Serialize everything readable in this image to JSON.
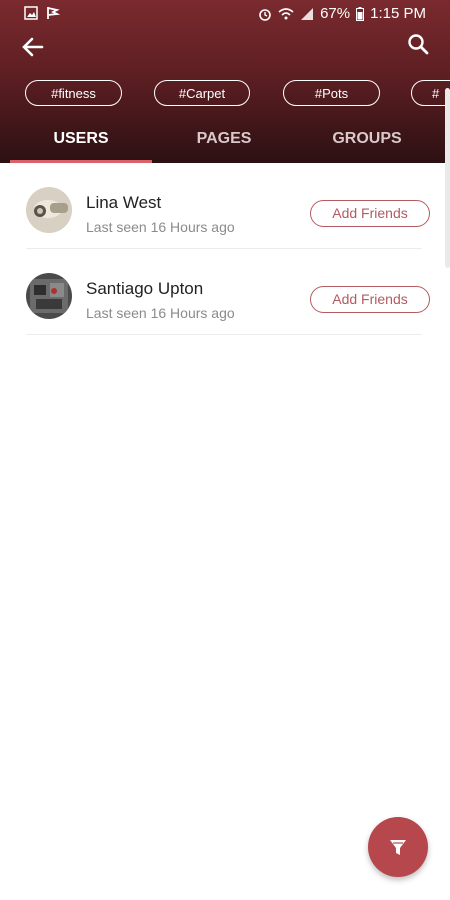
{
  "status_bar": {
    "battery": "67%",
    "time": "1:15 PM"
  },
  "chips": [
    "#fitness",
    "#Carpet",
    "#Pots",
    "#"
  ],
  "tabs": {
    "users": "USERS",
    "pages": "PAGES",
    "groups": "GROUPS",
    "active": "USERS"
  },
  "users": [
    {
      "name": "Lina West",
      "last_seen": "Last seen 16 Hours ago",
      "action": "Add Friends"
    },
    {
      "name": "Santiago Upton",
      "last_seen": "Last seen 16 Hours ago",
      "action": "Add Friends"
    }
  ],
  "colors": {
    "header_top": "#7a2a2e",
    "header_bottom": "#2c1012",
    "accent": "#b35b61",
    "fab": "#b5474d"
  },
  "icons": {
    "back": "arrow-left-icon",
    "search": "search-icon",
    "fab": "filter-icon"
  }
}
